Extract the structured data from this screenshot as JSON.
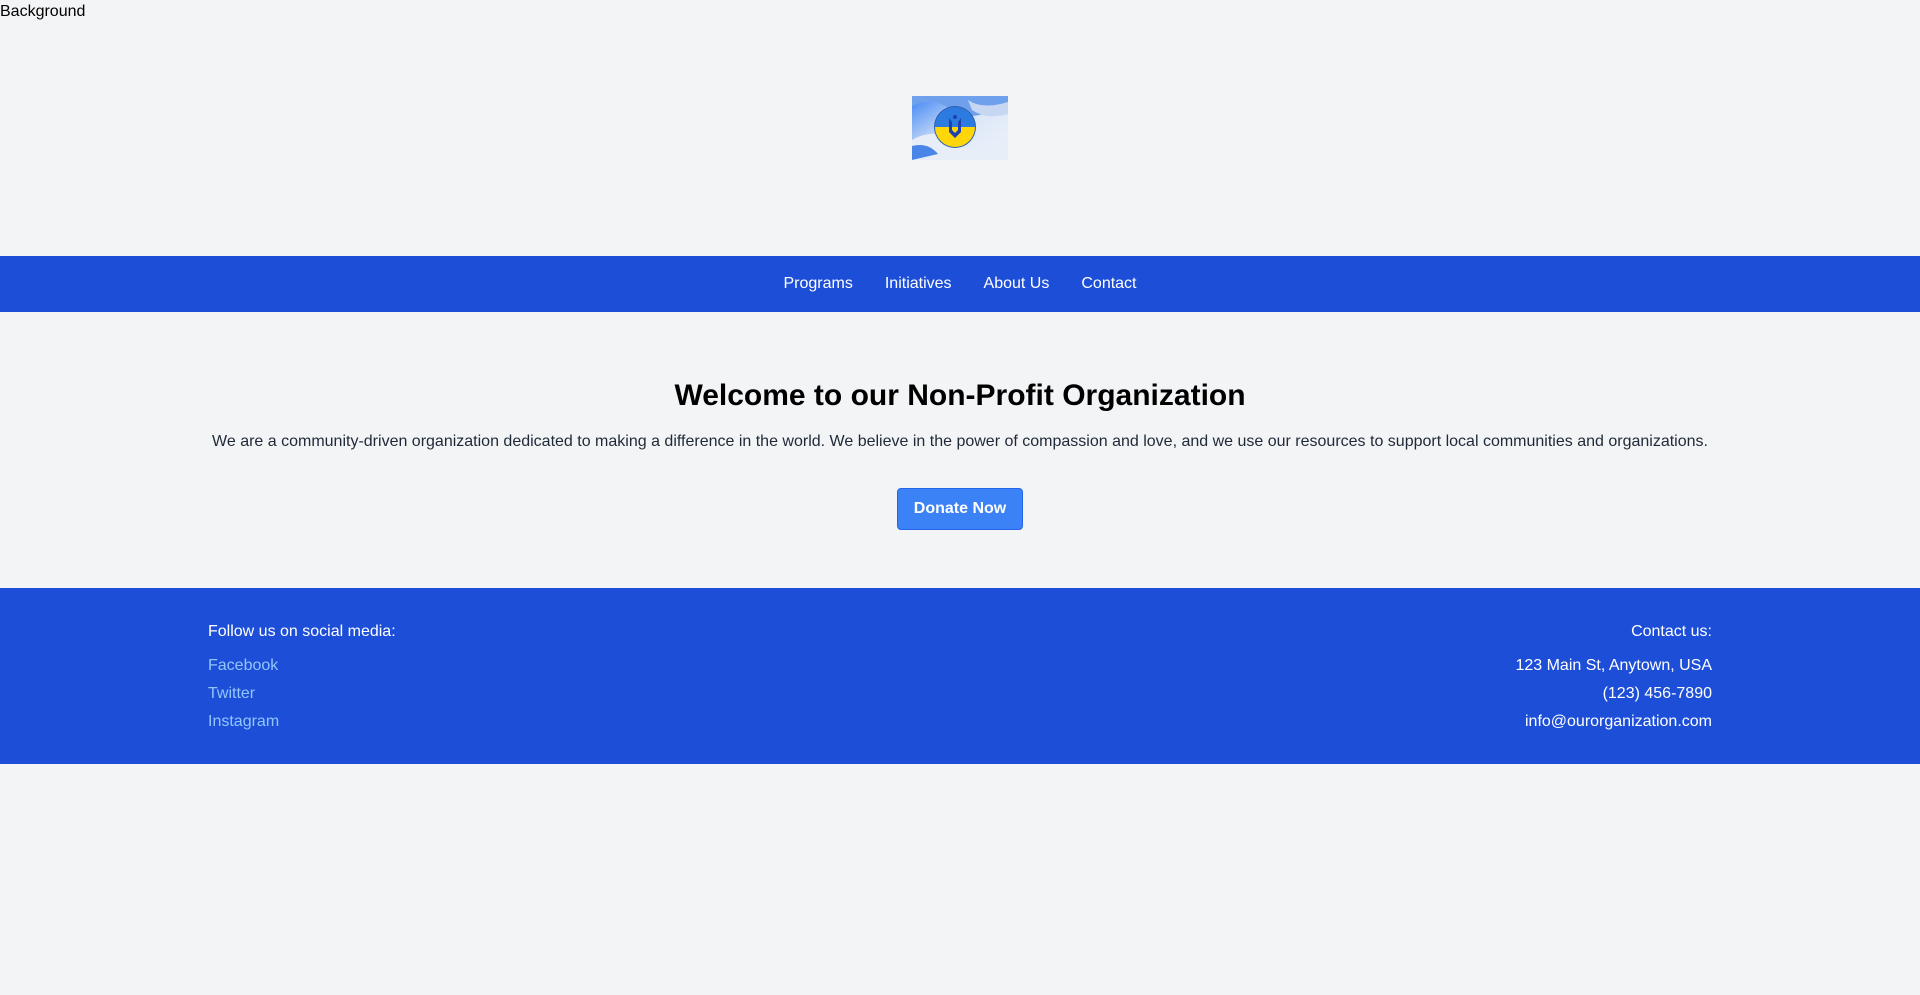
{
  "background_label": "Background",
  "logo": {
    "icon": "ukraine-trident-badge-icon"
  },
  "nav": {
    "items": [
      {
        "label": "Programs"
      },
      {
        "label": "Initiatives"
      },
      {
        "label": "About Us"
      },
      {
        "label": "Contact"
      }
    ]
  },
  "hero": {
    "title": "Welcome to our Non-Profit Organization",
    "description": "We are a community-driven organization dedicated to making a difference in the world. We believe in the power of compassion and love, and we use our resources to support local communities and organizations.",
    "donate_label": "Donate Now"
  },
  "footer": {
    "social_heading": "Follow us on social media:",
    "social_links": [
      {
        "label": "Facebook"
      },
      {
        "label": "Twitter"
      },
      {
        "label": "Instagram"
      }
    ],
    "contact_heading": "Contact us:",
    "address": "123 Main St, Anytown, USA",
    "phone": "(123) 456-7890",
    "email": "info@ourorganization.com"
  },
  "colors": {
    "primary": "#1d4ed8",
    "button": "#3b82f6",
    "link": "#93c5fd",
    "page_bg": "#f3f4f6"
  }
}
